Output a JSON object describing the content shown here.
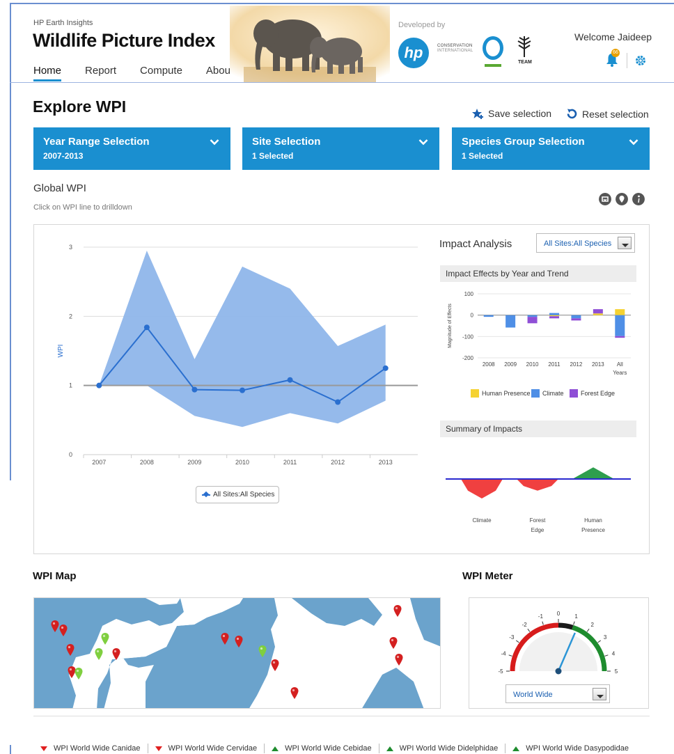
{
  "colors": {
    "accent": "#1a8fd0",
    "band": "#8fb6ea",
    "line": "#2a6fcf",
    "human_presence": "#f5d232",
    "climate": "#4f8fe6",
    "forest_edge": "#8f4fd6",
    "negative": "#f04040",
    "positive": "#2e9e4e"
  },
  "header": {
    "kicker": "HP Earth Insights",
    "title": "Wildlife Picture Index",
    "nav": [
      "Home",
      "Report",
      "Compute",
      "About"
    ],
    "developed_by": "Developed by",
    "hp_logo": "hp",
    "ci_logo_line1": "CONSERVATION",
    "ci_logo_line2": "INTERNATIONAL",
    "team_logo": "TEAM",
    "welcome": "Welcome Jaideep",
    "notification_count": "66"
  },
  "explore": {
    "title": "Explore WPI",
    "save_label": "Save selection",
    "reset_label": "Reset selection",
    "selectors": [
      {
        "title": "Year Range Selection",
        "value": "2007-2013"
      },
      {
        "title": "Site Selection",
        "value": "1 Selected"
      },
      {
        "title": "Species Group Selection",
        "value": "1 Selected"
      }
    ]
  },
  "global_wpi": {
    "title": "Global WPI",
    "subtitle": "Click on WPI line to drilldown",
    "series_button": "All Sites:All Species"
  },
  "impact": {
    "title": "Impact Analysis",
    "select_value": "All Sites:All Species",
    "effects_header": "Impact Effects by Year and Trend",
    "summary_header": "Summary of Impacts",
    "legend": [
      "Human Presence",
      "Climate",
      "Forest Edge"
    ]
  },
  "chart_data": [
    {
      "type": "line",
      "title": "Global WPI",
      "ylabel": "WPI",
      "ylim": [
        0,
        3
      ],
      "yticks": [
        0,
        1,
        2,
        3
      ],
      "x": [
        "2007",
        "2008",
        "2009",
        "2010",
        "2011",
        "2012",
        "2013"
      ],
      "series": [
        {
          "name": "All Sites:All Species",
          "values": [
            1.0,
            1.84,
            0.94,
            0.93,
            1.08,
            0.76,
            1.25
          ]
        }
      ],
      "band": {
        "upper": [
          1.0,
          2.95,
          1.38,
          2.72,
          2.4,
          1.57,
          1.88
        ],
        "lower": [
          1.0,
          1.0,
          0.56,
          0.4,
          0.6,
          0.45,
          0.78
        ]
      },
      "reference_line": 1.0,
      "legend_position": "bottom"
    },
    {
      "type": "bar",
      "title": "Impact Effects by Year and Trend",
      "ylabel": "Magnitude of Effects",
      "ylim": [
        -200,
        100
      ],
      "yticks": [
        100,
        0,
        -100,
        -200
      ],
      "categories": [
        "2008",
        "2009",
        "2010",
        "2011",
        "2012",
        "2013",
        "All Years"
      ],
      "series": [
        {
          "name": "Human Presence",
          "values": [
            0,
            0,
            0,
            -5,
            0,
            8,
            28
          ]
        },
        {
          "name": "Climate",
          "values": [
            -8,
            -58,
            -8,
            10,
            -15,
            0,
            -98
          ]
        },
        {
          "name": "Forest Edge",
          "values": [
            0,
            0,
            -30,
            -10,
            -10,
            20,
            -8
          ]
        }
      ]
    },
    {
      "type": "bar",
      "title": "Summary of Impacts",
      "categories": [
        "Climate",
        "Forest Edge",
        "Human Presence"
      ],
      "values": [
        -1,
        -0.6,
        0.6
      ]
    }
  ],
  "map": {
    "title": "WPI Map"
  },
  "meter": {
    "title": "WPI Meter",
    "ticks": [
      "-5",
      "-4",
      "-3",
      "-2",
      "-1",
      "0",
      "1",
      "2",
      "3",
      "4",
      "5"
    ],
    "value": 1.3,
    "select_value": "World Wide"
  },
  "species_legend": [
    {
      "label": "WPI World Wide Canidae",
      "trend": "down"
    },
    {
      "label": "WPI World Wide Cervidae",
      "trend": "down"
    },
    {
      "label": "WPI World Wide Cebidae",
      "trend": "up"
    },
    {
      "label": "WPI World Wide Didelphidae",
      "trend": "up"
    },
    {
      "label": "WPI World Wide Dasypodidae",
      "trend": "up"
    }
  ]
}
